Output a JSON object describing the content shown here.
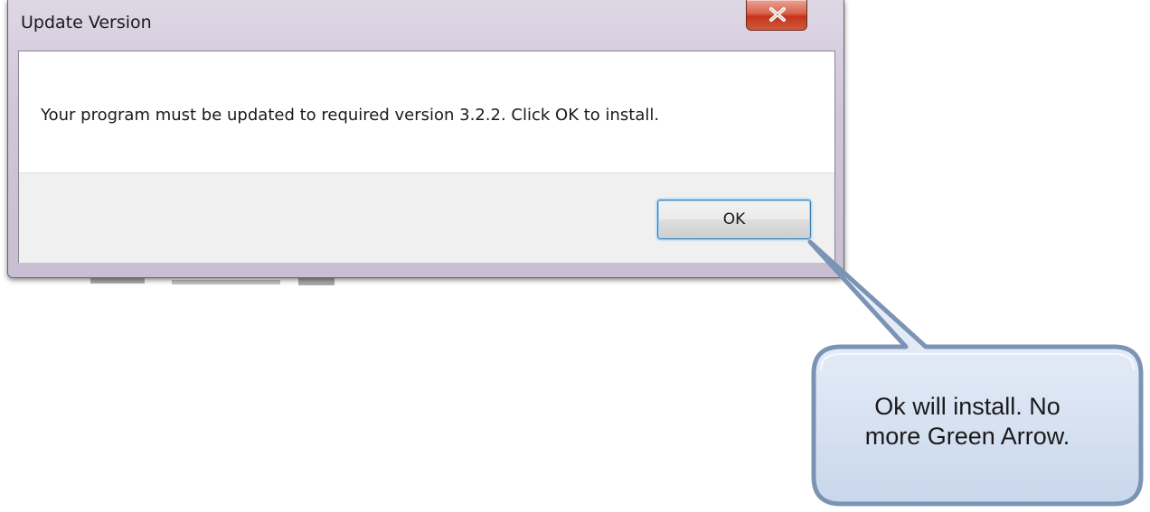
{
  "dialog": {
    "title": "Update Version",
    "message": "Your program must be updated to required version 3.2.2. Click OK to install.",
    "ok_label": "OK"
  },
  "callout": {
    "line1": "Ok will install.  No",
    "line2": "more Green Arrow."
  },
  "icons": {
    "close": "close-icon"
  },
  "colors": {
    "callout_fill": "#dce6f4",
    "callout_border": "#7b93b4",
    "close_button": "#c9452c",
    "ok_focus": "#3c7fb1"
  }
}
